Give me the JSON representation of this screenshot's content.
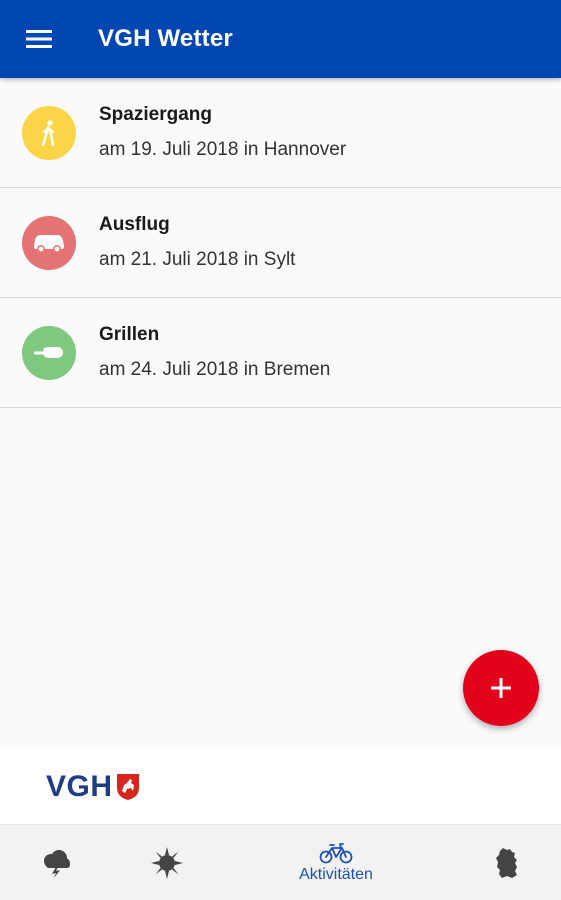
{
  "appbar": {
    "title": "VGH Wetter",
    "menu_icon": "hamburger-menu-icon",
    "background": "#0047b3"
  },
  "activities": [
    {
      "title": "Spaziergang",
      "subtitle": "am 19. Juli 2018 in Hannover",
      "icon": "walking-person-icon",
      "color": "#fcd447"
    },
    {
      "title": "Ausflug",
      "subtitle": "am 21. Juli 2018 in Sylt",
      "icon": "car-icon",
      "color": "#e57373"
    },
    {
      "title": "Grillen",
      "subtitle": "am 24. Juli 2018 in Bremen",
      "icon": "grill-sausage-icon",
      "color": "#7fc97f"
    }
  ],
  "fab": {
    "icon": "plus-icon",
    "color": "#e3001b"
  },
  "footer": {
    "logo_text": "VGH"
  },
  "bottom_nav": [
    {
      "icon": "storm-cloud-icon",
      "label": ""
    },
    {
      "icon": "sun-icon",
      "label": ""
    },
    {
      "icon": "bicycle-icon",
      "label": "Aktivitäten",
      "active": true
    },
    {
      "icon": "germany-map-icon",
      "label": ""
    }
  ]
}
